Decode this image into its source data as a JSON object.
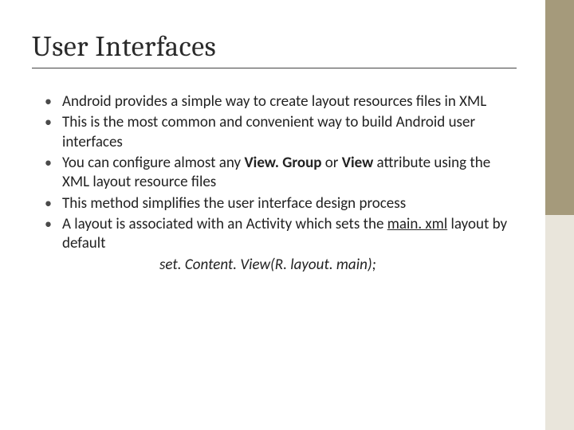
{
  "title": "User Interfaces",
  "bullets": {
    "b1": "Android provides a simple way to create layout resources files in XML",
    "b2": "This is the most common and convenient way to build Android user interfaces",
    "b3_a": "You can configure almost any ",
    "b3_vg": "View. Group",
    "b3_b": " or ",
    "b3_v": "View",
    "b3_c": " attribute using the XML layout resource files",
    "b4": "This method simplifies the user interface design process",
    "b5_a": "A layout is associated with an Activity which sets the ",
    "b5_u": "main. xml",
    "b5_b": " layout by default"
  },
  "code": "set. Content. View(R. layout. main);"
}
